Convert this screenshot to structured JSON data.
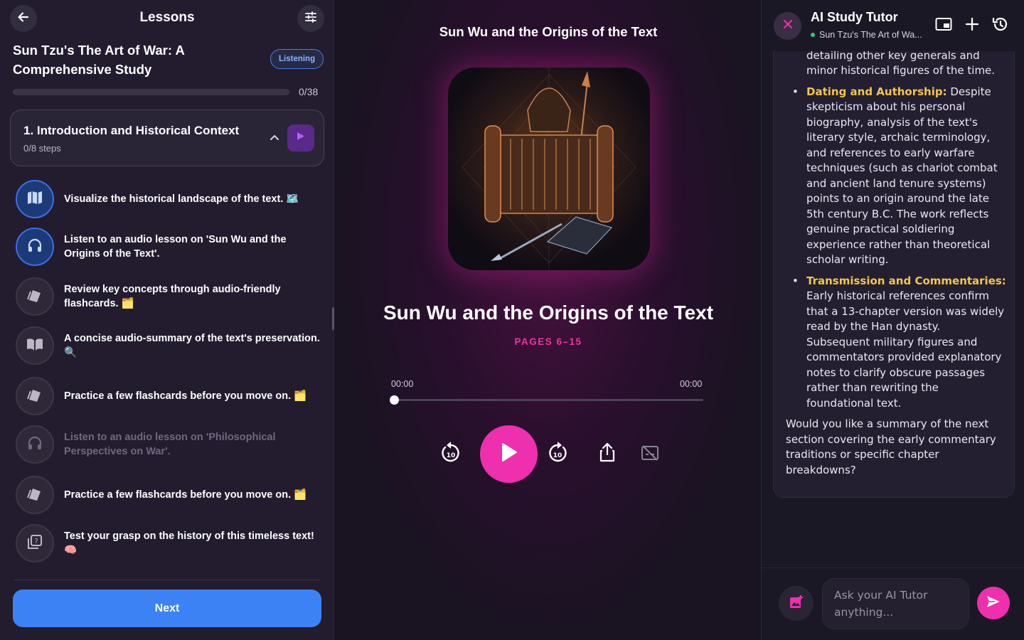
{
  "colors": {
    "accent_pink": "#ee2fae",
    "accent_blue": "#3d82f5",
    "keyword_yellow": "#f5c54a",
    "online_green": "#2ecc71"
  },
  "sidebar": {
    "title": "Lessons",
    "back_icon": "arrow-left-icon",
    "settings_icon": "sliders-icon",
    "course_title": "Sun Tzu's The Art of War: A Comprehensive Study",
    "mode_badge": "Listening",
    "progress": {
      "text": "0/38",
      "fraction": 0
    },
    "section": {
      "title": "1. Introduction and Historical Context",
      "steps_text": "0/8 steps"
    },
    "steps": [
      {
        "label": "Visualize the historical landscape of the text. 🗺️",
        "icon": "map-icon",
        "state": "active"
      },
      {
        "label": "Listen to an audio lesson on 'Sun Wu and the Origins of the Text'.",
        "icon": "headphones-icon",
        "state": "active"
      },
      {
        "label": "Review key concepts through audio-friendly flashcards. 🗂️",
        "icon": "flashcards-icon",
        "state": "normal"
      },
      {
        "label": "A concise audio-summary of the text's preservation. 🔍",
        "icon": "open-book-icon",
        "state": "normal"
      },
      {
        "label": "Practice a few flashcards before you move on. 🗂️",
        "icon": "flashcards-icon",
        "state": "normal"
      },
      {
        "label": "Listen to an audio lesson on 'Philosophical Perspectives on War'.",
        "icon": "headphones-icon",
        "state": "dim"
      },
      {
        "label": "Practice a few flashcards before you move on. 🗂️",
        "icon": "flashcards-icon",
        "state": "normal"
      },
      {
        "label": "Test your grasp on the history of this timeless text! 🧠",
        "icon": "quiz-icon",
        "state": "normal"
      }
    ],
    "next_label": "Next"
  },
  "player": {
    "now_playing_title": "Sun Wu and the Origins of the Text",
    "lesson_title": "Sun Wu and the Origins of the Text",
    "pages": "PAGES 6–15",
    "time_current": "00:00",
    "time_total": "00:00",
    "progress_fraction": 0,
    "controls": [
      "rewind-10-icon",
      "play-icon",
      "forward-10-icon",
      "share-icon",
      "captions-off-icon"
    ]
  },
  "tutor": {
    "name": "AI Study Tutor",
    "status": "Sun Tzu's The Art of Wa...",
    "message": {
      "partial_top": "era fail to mention him, despite detailing other key generals and minor historical figures of the time.",
      "bullets": [
        {
          "keyword": "Dating and Authorship:",
          "text": " Despite skepticism about his personal biography, analysis of the text's literary style, archaic terminology, and references to early warfare techniques (such as chariot combat and ancient land tenure systems) points to an origin around the late 5th century B.C. The work reflects genuine practical soldiering experience rather than theoretical scholar writing."
        },
        {
          "keyword": "Transmission and Commentaries:",
          "text": " Early historical references confirm that a 13-chapter version was widely read by the Han dynasty. Subsequent military figures and commentators provided explanatory notes to clarify obscure passages rather than rewriting the foundational text."
        }
      ],
      "outro": "Would you like a summary of the next section covering the early commentary traditions or specific chapter breakdowns?"
    },
    "input_placeholder": "Ask your AI Tutor anything..."
  }
}
